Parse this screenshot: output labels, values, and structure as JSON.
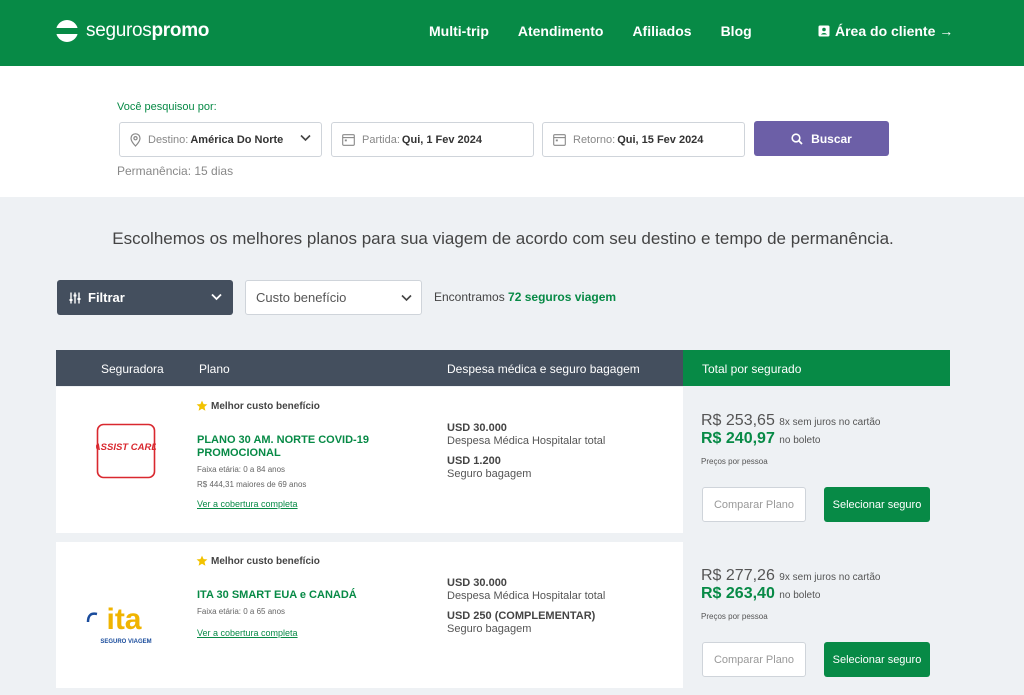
{
  "header": {
    "logo_light": "seguros",
    "logo_bold": "promo",
    "nav": [
      {
        "label": "Multi-trip"
      },
      {
        "label": "Atendimento"
      },
      {
        "label": "Afiliados"
      },
      {
        "label": "Blog"
      }
    ],
    "client_area": "Área do cliente →"
  },
  "search": {
    "label": "Você pesquisou por:",
    "destination_label": "Destino:",
    "destination_value": "América Do Norte",
    "departure_label": "Partida:",
    "departure_value": "Qui, 1 Fev 2024",
    "return_label": "Retorno:",
    "return_value": "Qui, 15 Fev 2024",
    "search_button": "Buscar",
    "stay": "Permanência: 15 dias"
  },
  "intro": "Escolhemos os melhores planos para sua viagem de acordo com seu destino e tempo de permanência.",
  "filters": {
    "filter_button": "Filtrar",
    "sort_value": "Custo benefício",
    "found_prefix": "Encontramos",
    "found_count": "72 seguros viagem"
  },
  "table": {
    "headers": {
      "insurer": "Seguradora",
      "plan": "Plano",
      "coverage": "Despesa médica e seguro bagagem",
      "total": "Total por segurado"
    }
  },
  "plans": [
    {
      "badge": "Melhor custo benefício",
      "logo_text": "ASSIST CARD",
      "name": "PLANO 30 AM. NORTE COVID-19 PROMOCIONAL",
      "age_range": "Faixa etária: 0 a 84 anos",
      "extra_info": "R$ 444,31 maiores de 69 anos",
      "coverage_link": "Ver a cobertura completa",
      "medical_amount": "USD 30.000",
      "medical_desc": "Despesa Médica Hospitalar total",
      "baggage_amount": "USD 1.200",
      "baggage_desc": "Seguro bagagem",
      "price_card": "R$ 253,65",
      "installments": "8x sem juros no cartão",
      "price_boleto": "R$ 240,97",
      "boleto_label": "no boleto",
      "per_person": "Preços por pessoa",
      "compare_button": "Comparar Plano",
      "select_button": "Selecionar seguro"
    },
    {
      "badge": "Melhor custo benefício",
      "logo_text": "ita",
      "logo_sub": "SEGURO VIAGEM",
      "name": "ITA 30 SMART EUA e CANADÁ",
      "age_range": "Faixa etária: 0 a 65 anos",
      "coverage_link": "Ver a cobertura completa",
      "medical_amount": "USD 30.000",
      "medical_desc": "Despesa Médica Hospitalar total",
      "baggage_amount": "USD 250 (COMPLEMENTAR)",
      "baggage_desc": "Seguro bagagem",
      "price_card": "R$ 277,26",
      "installments": "9x sem juros no cartão",
      "price_boleto": "R$ 263,40",
      "boleto_label": "no boleto",
      "per_person": "Preços por pessoa",
      "compare_button": "Comparar Plano",
      "select_button": "Selecionar seguro"
    }
  ],
  "colors": {
    "brand_green": "#078a46",
    "search_purple": "#6c5fa7",
    "dark_slate": "#444f5e",
    "page_bg": "#eef1f4"
  }
}
